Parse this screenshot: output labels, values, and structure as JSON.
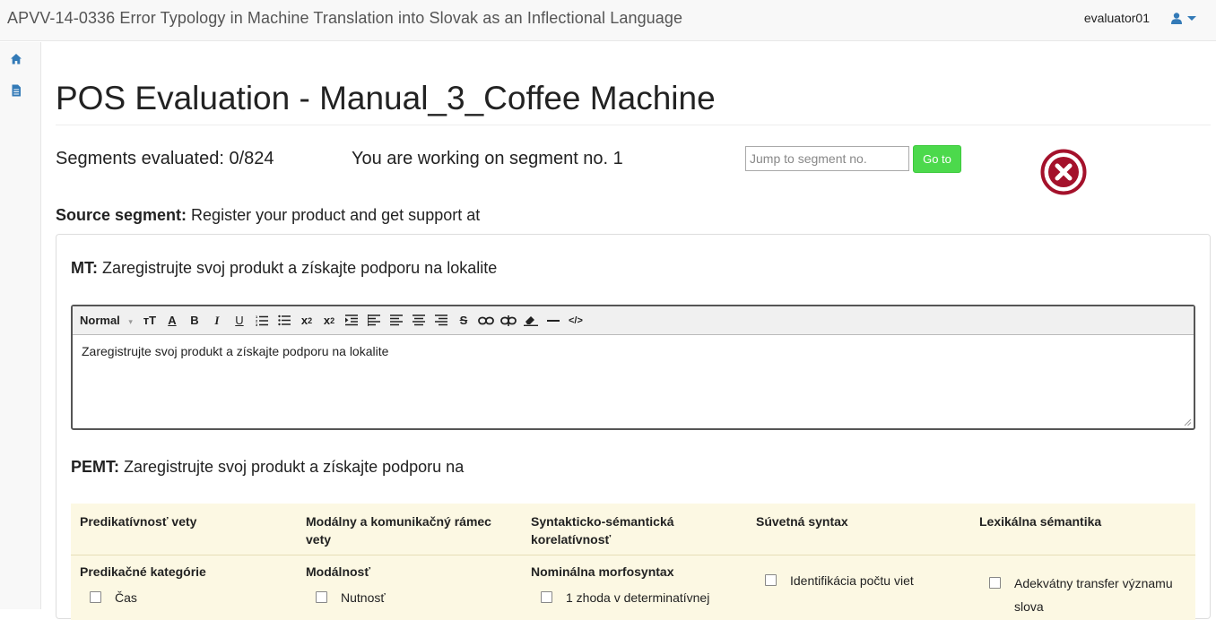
{
  "header": {
    "app_title": "APVV-14-0336 Error Typology in Machine Translation into Slovak as an Inflectional Language",
    "username": "evaluator01",
    "user_icon": "user-icon"
  },
  "sidebar": {
    "items": [
      {
        "icon": "home-icon"
      },
      {
        "icon": "document-icon"
      }
    ]
  },
  "main": {
    "title": "POS Evaluation - Manual_3_Coffee Machine",
    "segments_evaluated": "Segments evaluated: 0/824",
    "working_on": "You are working on segment no. 1",
    "jump_placeholder": "Jump to segment no.",
    "go_label": "Go to",
    "close_icon": "close-circle-icon",
    "close_color": "#a4112b",
    "source_label": "Source segment:",
    "source_text": " Register your product and get support at",
    "mt_label": "MT:",
    "mt_text": " Zaregistrujte svoj produkt a získajte podporu na lokalite",
    "editor": {
      "format_select": "Normal",
      "content": "Zaregistrujte svoj produkt a získajte podporu na lokalite",
      "toolbar": [
        "font-size-icon",
        "text-color-icon",
        "bold-icon",
        "italic-icon",
        "underline-icon",
        "ordered-list-icon",
        "bullet-list-icon",
        "subscript-icon",
        "superscript-icon",
        "indent-icon",
        "align-left-icon",
        "align-center-icon",
        "align-right-icon",
        "justify-icon",
        "strikethrough-icon",
        "link-icon",
        "unlink-icon",
        "clear-format-icon",
        "horizontal-rule-icon",
        "source-code-icon"
      ]
    },
    "pemt_label": "PEMT:",
    "pemt_text": " Zaregistrujte svoj produkt a získajte podporu na",
    "categories": {
      "headers": [
        "Predikatívnosť vety",
        "Modálny a komunikačný rámec vety",
        "Syntakticko-sémantická korelatívnosť",
        "Súvetná syntax",
        "Lexikálna sémantika"
      ],
      "subheaders": [
        "Predikačné kategórie",
        "Modálnosť",
        "Nominálna morfosyntax",
        "",
        ""
      ],
      "items": [
        "Čas",
        "Nutnosť",
        "1 zhoda v determinatívnej",
        "Identifikácia počtu viet",
        "Adekvátny transfer významu slova"
      ]
    }
  }
}
